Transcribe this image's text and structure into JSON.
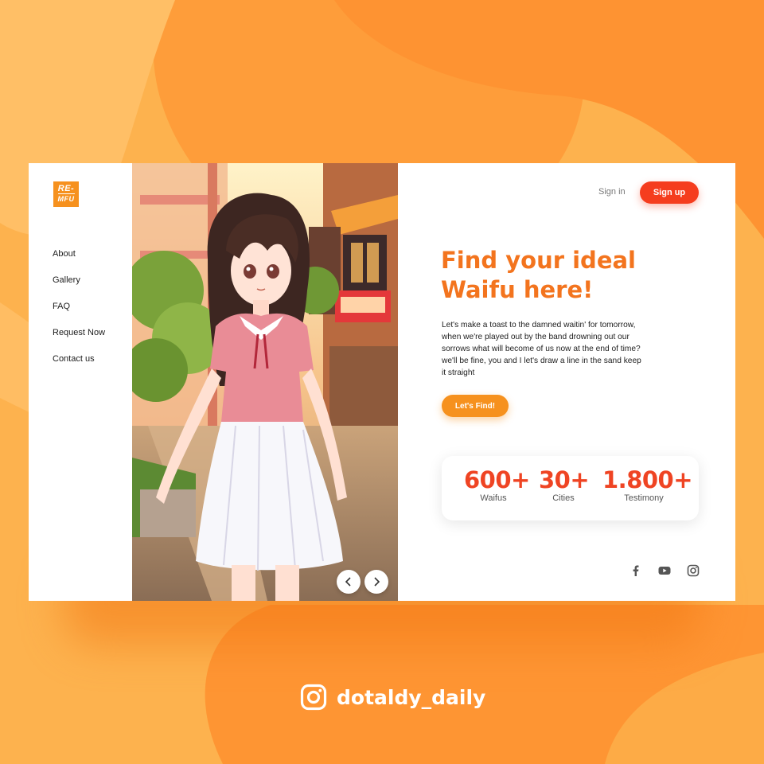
{
  "brand": {
    "logo_line1": "RE-",
    "logo_line2": "MFU",
    "accent_color": "#f6911e"
  },
  "nav": {
    "items": [
      "About",
      "Gallery",
      "FAQ",
      "Request Now",
      "Contact us"
    ]
  },
  "header": {
    "signin_label": "Sign in",
    "signup_label": "Sign up",
    "signup_color": "#f53d1e"
  },
  "hero": {
    "headline_line1": "Find your ideal",
    "headline_line2": "Waifu here!",
    "description": "Let's make a toast to the damned waitin' for tomorrow, when we're played out by the band drowning out our sorrows what will become of us now at the end of time? we'll be fine, you and I let's draw a line in the sand keep it straight",
    "cta_label": "Let's Find!"
  },
  "stats": [
    {
      "value": "600+",
      "label": "Waifus"
    },
    {
      "value": "30+",
      "label": "Cities"
    },
    {
      "value": "1.800+",
      "label": "Testimony"
    }
  ],
  "carousel": {
    "prev_icon": "chevron-left-icon",
    "next_icon": "chevron-right-icon"
  },
  "social": {
    "icons": [
      "facebook-icon",
      "youtube-icon",
      "instagram-icon"
    ]
  },
  "footer": {
    "instagram_handle": "dotaldy_daily"
  }
}
